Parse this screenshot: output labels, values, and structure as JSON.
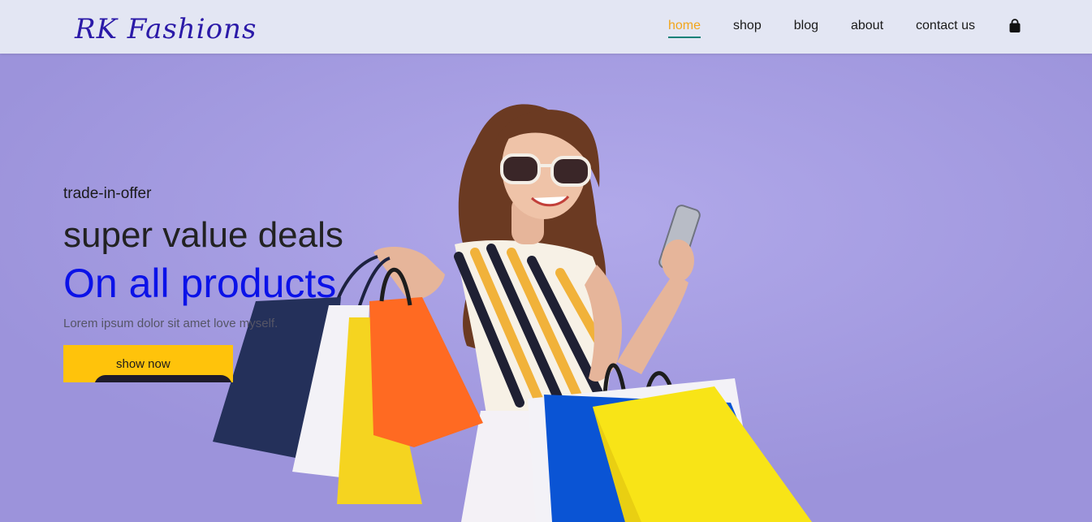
{
  "header": {
    "logo": "RK Fashions",
    "nav": [
      {
        "label": "home",
        "active": true
      },
      {
        "label": "shop",
        "active": false
      },
      {
        "label": "blog",
        "active": false
      },
      {
        "label": "about",
        "active": false
      },
      {
        "label": "contact us",
        "active": false
      }
    ],
    "cart_icon": "shopping-bag-icon"
  },
  "hero": {
    "trade_offer": "trade-in-offer",
    "heading_line1": "super value deals",
    "heading_line2": "On all products",
    "description": "Lorem ipsum dolor sit amet love myself.",
    "button_label": "show now",
    "image": "woman-with-shopping-bags"
  },
  "colors": {
    "header_bg": "#e3e6f3",
    "hero_bg": "#a49be0",
    "logo": "#2b1aa8",
    "nav_active": "#f2a51a",
    "nav_underline": "#088178",
    "heading_accent": "#0b12e8",
    "button_bg": "#ffc30b"
  }
}
